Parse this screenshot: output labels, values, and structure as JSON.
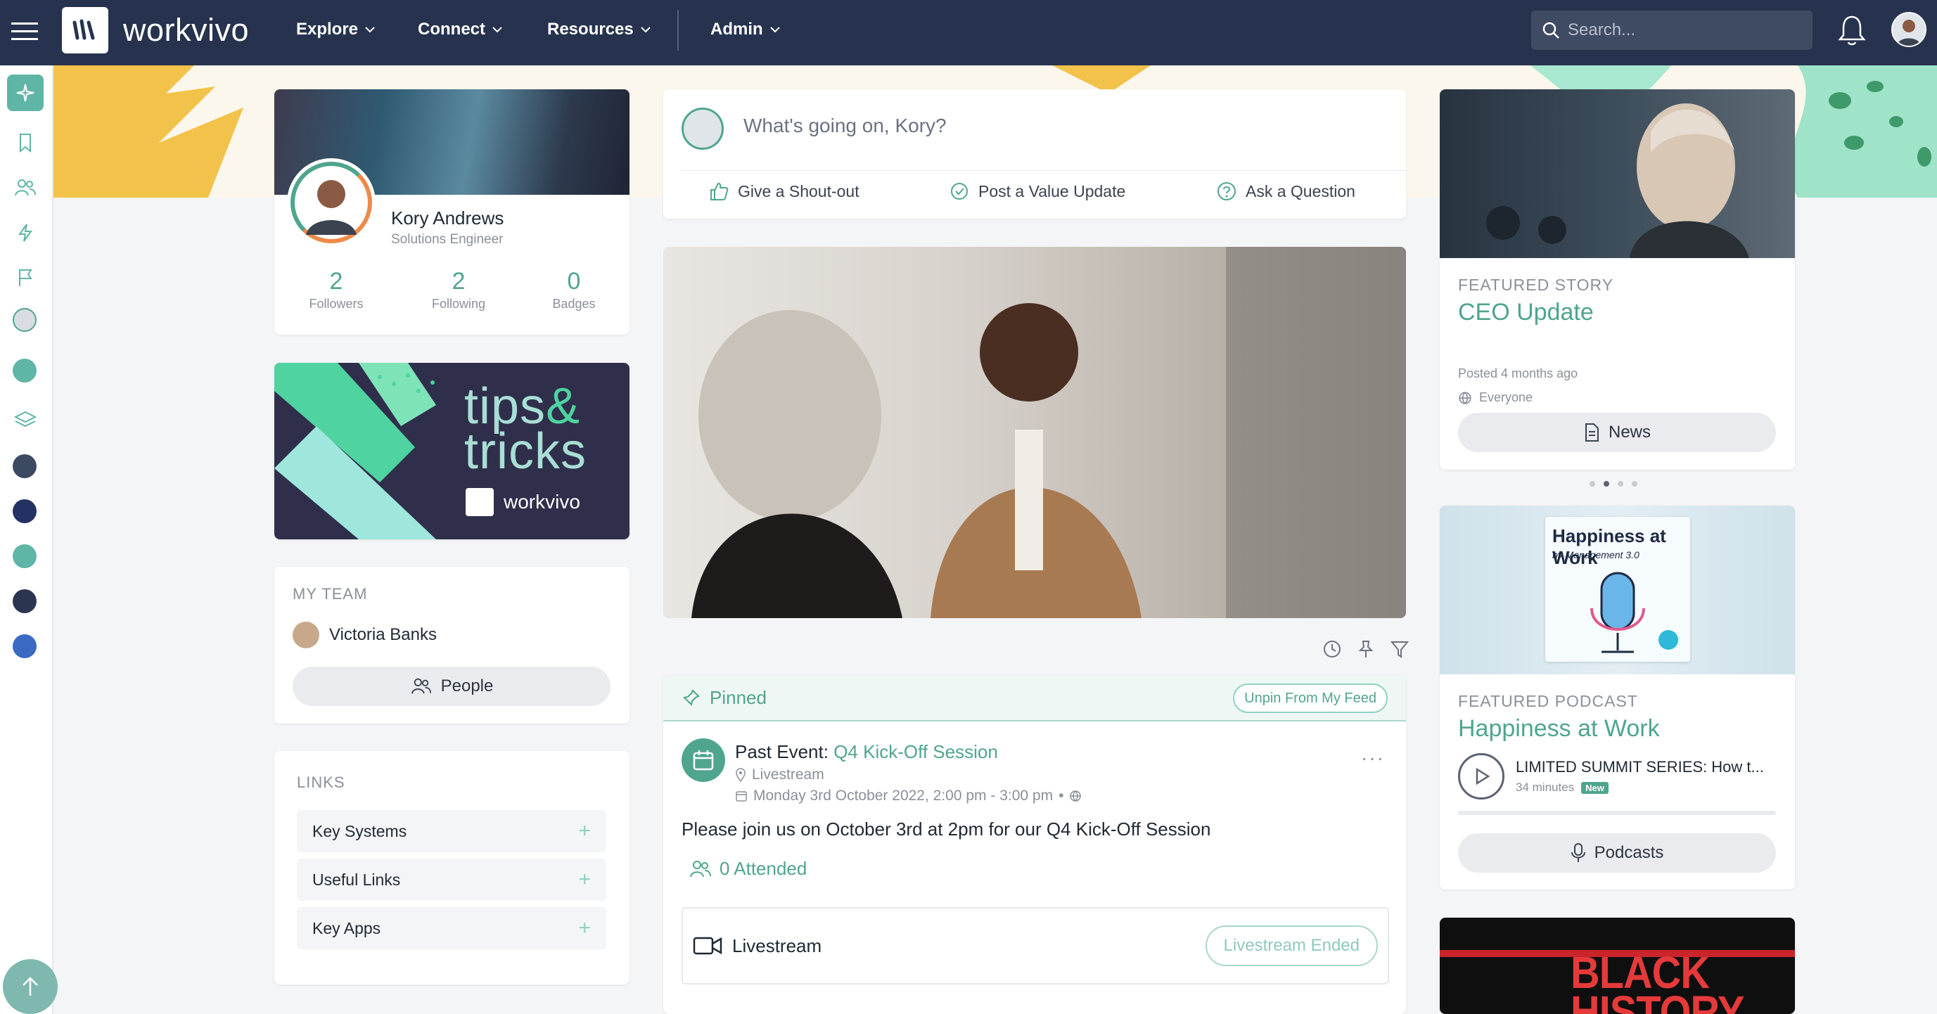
{
  "app": {
    "name": "workvivo",
    "nav": [
      "Explore",
      "Connect",
      "Resources",
      "Admin"
    ],
    "search_placeholder": "Search..."
  },
  "colors": {
    "topbar": "#27334e",
    "accent": "#4fa58e",
    "rail_active": "#5fb5a6"
  },
  "rail": {
    "icons": [
      "sparkle-icon",
      "bookmark-icon",
      "people-icon",
      "lightning-icon",
      "flag-icon",
      "avatar",
      "compass-icon",
      "layers-icon",
      "space-icon",
      "space-icon",
      "space-icon",
      "space-icon",
      "space-icon"
    ]
  },
  "profile": {
    "name": "Kory Andrews",
    "role": "Solutions Engineer",
    "stats": [
      {
        "value": "2",
        "label": "Followers"
      },
      {
        "value": "2",
        "label": "Following"
      },
      {
        "value": "0",
        "label": "Badges"
      }
    ]
  },
  "tips": {
    "line1": "tips",
    "amp": "&",
    "line2": "tricks",
    "brand": "workvivo"
  },
  "team": {
    "label": "MY TEAM",
    "member": "Victoria Banks",
    "button": "People"
  },
  "links": {
    "label": "LINKS",
    "items": [
      "Key Systems",
      "Useful Links",
      "Key Apps"
    ]
  },
  "composer": {
    "placeholder": "What's going on, Kory?",
    "actions": [
      "Give a Shout-out",
      "Post a Value Update",
      "Ask a Question"
    ]
  },
  "pinned": {
    "label": "Pinned",
    "unpin": "Unpin From My Feed",
    "event_prefix": "Past Event:",
    "event_name": "Q4 Kick-Off Session",
    "location": "Livestream",
    "datetime": "Monday 3rd October 2022, 2:00 pm - 3:00 pm",
    "body": "Please join us on October 3rd at 2pm for our Q4 Kick-Off Session",
    "attended": "0 Attended",
    "livestream_label": "Livestream",
    "livestream_status": "Livestream Ended",
    "more": "···"
  },
  "featured_story": {
    "label": "FEATURED STORY",
    "title": "CEO Update",
    "posted": "Posted 4 months ago",
    "audience": "Everyone",
    "button": "News"
  },
  "featured_podcast": {
    "label": "FEATURED PODCAST",
    "title": "Happiness at Work",
    "cover_title": "Happiness at Work",
    "cover_subtitle": "by Management 3.0",
    "episode_title": "LIMITED SUMMIT SERIES: How t...",
    "duration": "34 minutes",
    "badge": "New",
    "button": "Podcasts"
  },
  "bh": {
    "line1": "BLACK",
    "line2": "HISTORY"
  }
}
